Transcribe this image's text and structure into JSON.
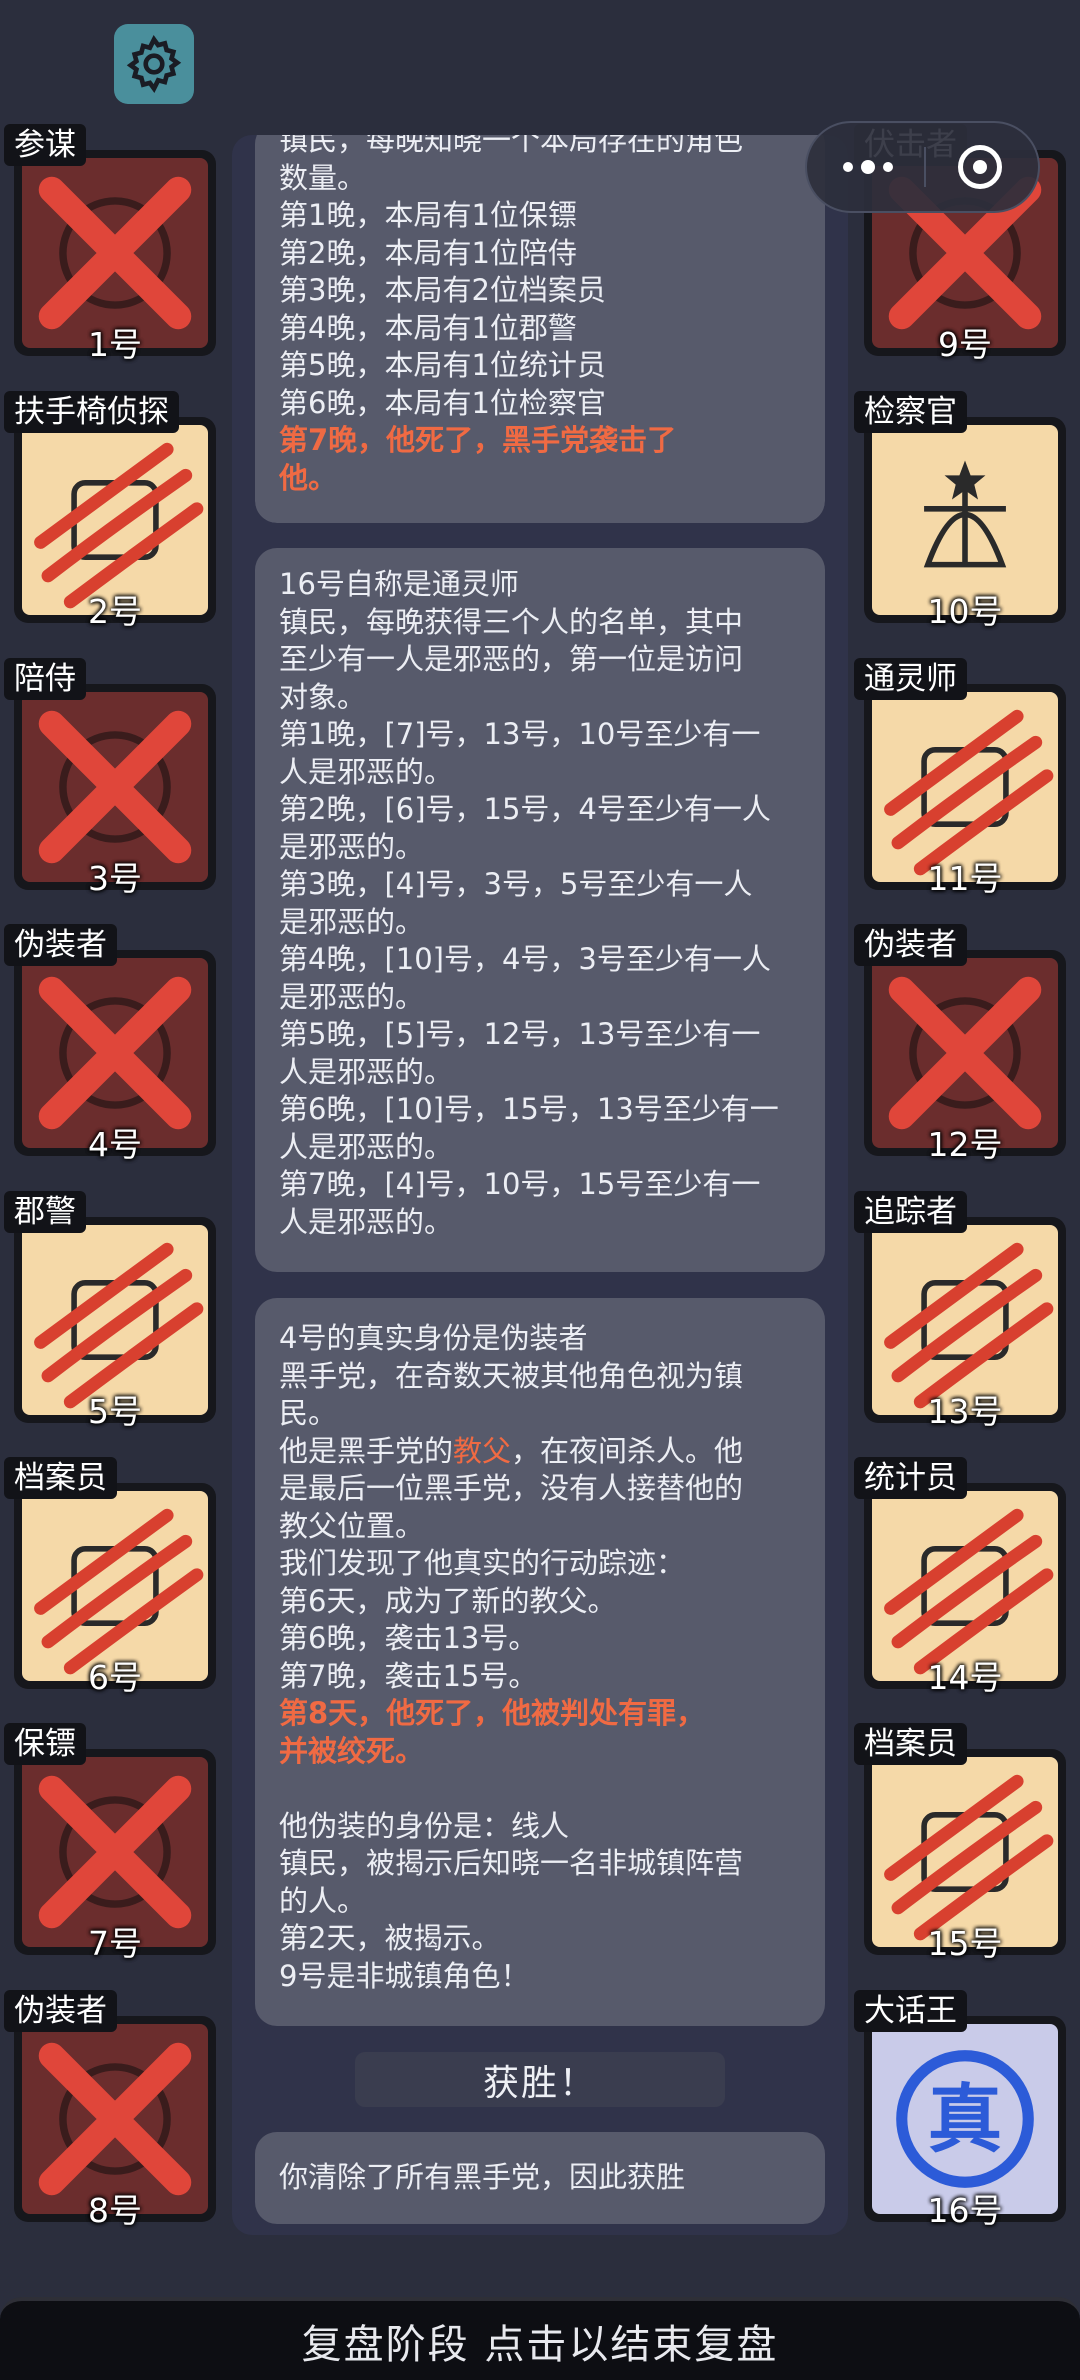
{
  "colors": {
    "background": "#2b2e3d",
    "card": "#575a6b",
    "highlight": "#f06a43",
    "dead_tile": "#6b2d2d",
    "alive_tile": "#f5d9a8"
  },
  "icons": {
    "settings": "gear-icon",
    "more": "more-dots-icon",
    "close": "target-icon"
  },
  "players_left": [
    {
      "role": "参谋",
      "number": "1号",
      "status": "x"
    },
    {
      "role": "扶手椅侦探",
      "number": "2号",
      "status": "claw"
    },
    {
      "role": "陪侍",
      "number": "3号",
      "status": "x"
    },
    {
      "role": "伪装者",
      "number": "4号",
      "status": "x"
    },
    {
      "role": "郡警",
      "number": "5号",
      "status": "claw"
    },
    {
      "role": "档案员",
      "number": "6号",
      "status": "claw"
    },
    {
      "role": "保镖",
      "number": "7号",
      "status": "x"
    },
    {
      "role": "伪装者",
      "number": "8号",
      "status": "x"
    }
  ],
  "players_right": [
    {
      "role": "伏击者",
      "number": "9号",
      "status": "x"
    },
    {
      "role": "检察官",
      "number": "10号",
      "status": "alive"
    },
    {
      "role": "通灵师",
      "number": "11号",
      "status": "claw"
    },
    {
      "role": "伪装者",
      "number": "12号",
      "status": "x"
    },
    {
      "role": "追踪者",
      "number": "13号",
      "status": "claw"
    },
    {
      "role": "统计员",
      "number": "14号",
      "status": "claw"
    },
    {
      "role": "档案员",
      "number": "15号",
      "status": "claw"
    },
    {
      "role": "大话王",
      "number": "16号",
      "status": "blue"
    }
  ],
  "card1": {
    "lines": [
      "镇民，每晚知晓一个本局存在的角色",
      "数量。",
      "第1晚，本局有1位保镖",
      "第2晚，本局有1位陪侍",
      "第3晚，本局有2位档案员",
      "第4晚，本局有1位郡警",
      "第5晚，本局有1位统计员",
      "第6晚，本局有1位检察官"
    ],
    "highlight_lines": [
      "第7晚，他死了，黑手党袭击了",
      "他。"
    ]
  },
  "card2": {
    "lines": [
      "16号自称是通灵师",
      "镇民，每晚获得三个人的名单，其中",
      "至少有一人是邪恶的，第一位是访问",
      "对象。",
      "第1晚，[7]号，13号，10号至少有一",
      "人是邪恶的。",
      "第2晚，[6]号，15号，4号至少有一人",
      "是邪恶的。",
      "第3晚，[4]号，3号，5号至少有一人",
      "是邪恶的。",
      "第4晚，[10]号，4号，3号至少有一人",
      "是邪恶的。",
      "第5晚，[5]号，12号，13号至少有一",
      "人是邪恶的。",
      "第6晚，[10]号，15号，13号至少有一",
      "人是邪恶的。",
      "第7晚，[4]号，10号，15号至少有一",
      "人是邪恶的。"
    ]
  },
  "card3": {
    "l1": "4号的真实身份是伪装者",
    "l2": "黑手党，在奇数天被其他角色视为镇",
    "l3": "民。",
    "l4a": "他是黑手党的",
    "l4b": "教父",
    "l4c": "，在夜间杀人。他",
    "l5": "是最后一位黑手党，没有人接替他的",
    "l6": "教父位置。",
    "l7": "我们发现了他真实的行动踪迹：",
    "l8": "第6天，成为了新的教父。",
    "l9": "第6晚，袭击13号。",
    "l10": "第7晚，袭击15号。",
    "h1": "第8天，他死了，他被判处有罪，",
    "h2": "并被绞死。",
    "l11": "他伪装的身份是：线人",
    "l12": "镇民，被揭示后知晓一名非城镇阵营",
    "l13": "的人。",
    "l14": "第2天，被揭示。",
    "l15": "9号是非城镇角色！"
  },
  "win_button": "获胜！",
  "result_text": "你清除了所有黑手党，因此获胜",
  "bottom_bar": "复盘阶段 点击以结束复盘"
}
